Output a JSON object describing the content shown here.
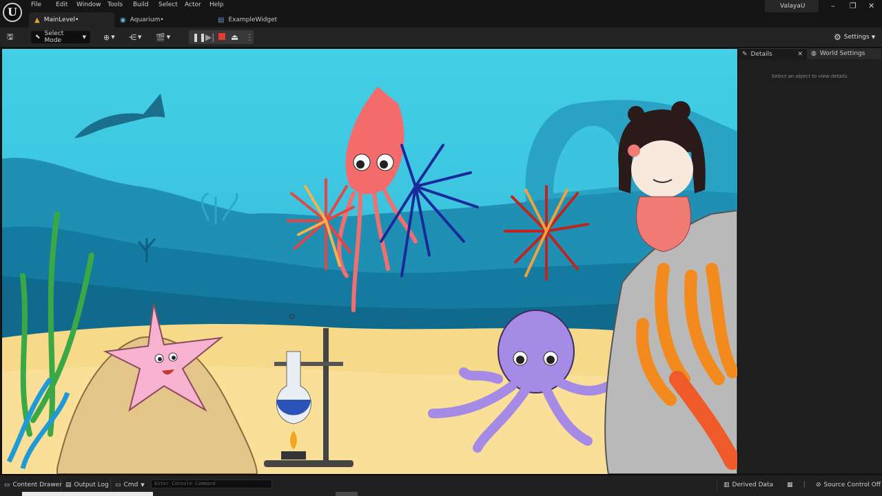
{
  "menu": [
    "File",
    "Edit",
    "Window",
    "Tools",
    "Build",
    "Select",
    "Actor",
    "Help"
  ],
  "tabs": [
    {
      "label": "MainLevel•",
      "icon": "level-icon"
    },
    {
      "label": "Aquarium•",
      "icon": "blueprint-icon"
    },
    {
      "label": "ExampleWidget",
      "icon": "widget-icon"
    }
  ],
  "user": "ValayaU",
  "toolbar": {
    "select_mode": "Select Mode",
    "settings": "Settings"
  },
  "details": {
    "tab_details": "Details",
    "tab_world": "World Settings",
    "hint": "Select an object to view details."
  },
  "statusbar": {
    "content_drawer": "Content Drawer",
    "output_log": "Output Log",
    "cmd": "Cmd",
    "console_placeholder": "Enter Console Command",
    "derived_data": "Derived Data",
    "source_control": "Source Control Off"
  },
  "colors": {
    "accent_play_stop": "#e53935",
    "ocean": "#3ec6de",
    "sand": "#f7d98a"
  }
}
